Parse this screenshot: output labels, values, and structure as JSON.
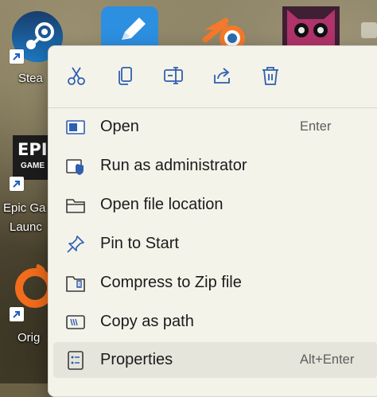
{
  "desktop": {
    "icons": [
      {
        "name": "steam",
        "label": "Stea"
      },
      {
        "name": "epic",
        "label_line1": "Epic Ga",
        "label_line2": "Launc",
        "logo_text": "EPIC",
        "logo_sub": "GAME"
      },
      {
        "name": "origin",
        "label": "Orig"
      }
    ]
  },
  "menu": {
    "toolbar": [
      {
        "name": "cut",
        "icon": "scissors-icon"
      },
      {
        "name": "copy",
        "icon": "copy-icon"
      },
      {
        "name": "rename",
        "icon": "rename-icon"
      },
      {
        "name": "share",
        "icon": "share-icon"
      },
      {
        "name": "delete",
        "icon": "trash-icon"
      }
    ],
    "items": [
      {
        "label": "Open",
        "shortcut": "Enter",
        "icon": "open-window-icon"
      },
      {
        "label": "Run as administrator",
        "shortcut": "",
        "icon": "shield-icon"
      },
      {
        "label": "Open file location",
        "shortcut": "",
        "icon": "folder-icon"
      },
      {
        "label": "Pin to Start",
        "shortcut": "",
        "icon": "pin-icon"
      },
      {
        "label": "Compress to Zip file",
        "shortcut": "",
        "icon": "zip-folder-icon"
      },
      {
        "label": "Copy as path",
        "shortcut": "",
        "icon": "path-icon"
      },
      {
        "label": "Properties",
        "shortcut": "Alt+Enter",
        "icon": "properties-icon"
      }
    ]
  },
  "colors": {
    "accent": "#2e5fb0",
    "menu_bg": "#f4f3ea",
    "hover_bg": "#e6e5dc"
  }
}
